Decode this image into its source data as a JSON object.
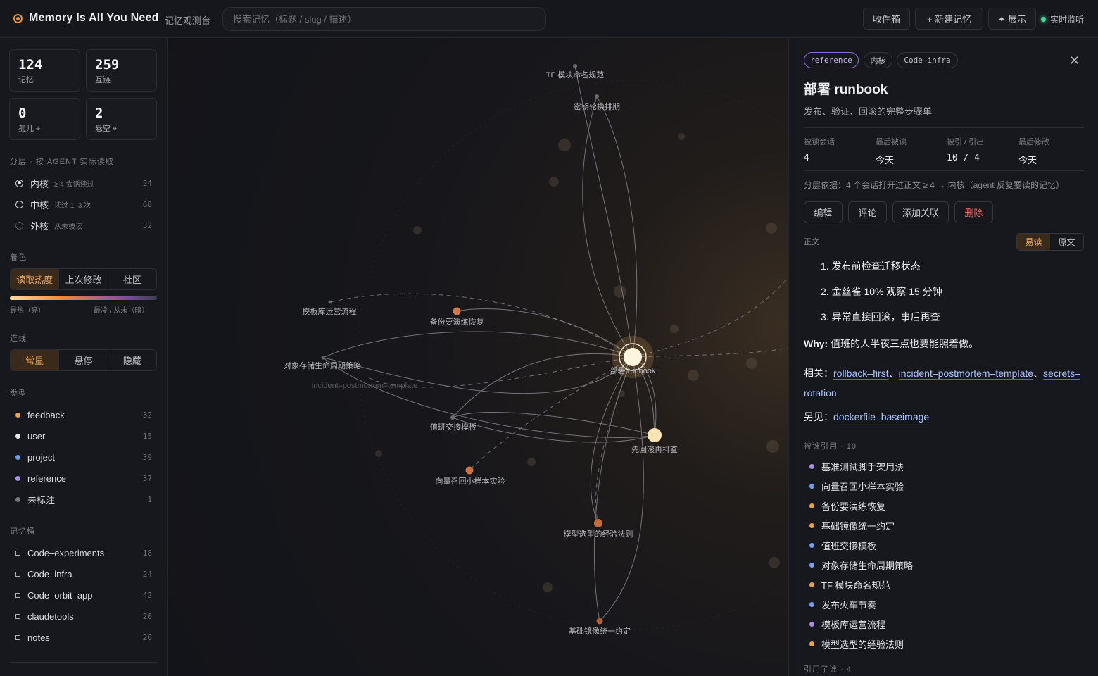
{
  "app": {
    "title": "Memory Is All You Need",
    "subtitle": "记忆观测台"
  },
  "search": {
    "placeholder": "搜索记忆（标题 / slug / 描述）"
  },
  "toolbar": {
    "inbox": "收件箱",
    "new_memory": "+ 新建记忆",
    "show": "✦ 展示",
    "live": "实时监听"
  },
  "stats": [
    {
      "num": "124",
      "label": "记忆"
    },
    {
      "num": "259",
      "label": "互链"
    },
    {
      "num": "0",
      "label": "孤儿 ⌖"
    },
    {
      "num": "2",
      "label": "悬空 ⌖"
    }
  ],
  "layers": {
    "title": "分层 · 按 AGENT 实际读取",
    "items": [
      {
        "name": "内核",
        "hint": "≥ 4 会话读过",
        "count": "24"
      },
      {
        "name": "中核",
        "hint": "读过 1–3 次",
        "count": "68"
      },
      {
        "name": "外核",
        "hint": "从未被读",
        "count": "32"
      }
    ]
  },
  "coloring": {
    "title": "着色",
    "options": [
      "读取热度",
      "上次修改",
      "社区"
    ],
    "hot": "最热（亮）",
    "cold": "最冷 / 从未（暗）"
  },
  "links": {
    "title": "连线",
    "options": [
      "常显",
      "悬停",
      "隐藏"
    ]
  },
  "types": {
    "title": "类型",
    "items": [
      {
        "name": "feedback",
        "count": "32",
        "color": "#f0a040"
      },
      {
        "name": "user",
        "count": "15",
        "color": "#e8e8ee"
      },
      {
        "name": "project",
        "count": "39",
        "color": "#6fa0f0"
      },
      {
        "name": "reference",
        "count": "37",
        "color": "#a98ae8"
      },
      {
        "name": "未标注",
        "count": "1",
        "color": "#777780"
      }
    ]
  },
  "buckets": {
    "title": "记忆桶",
    "items": [
      {
        "name": "Code–experiments",
        "count": "18"
      },
      {
        "name": "Code–infra",
        "count": "24"
      },
      {
        "name": "Code–orbit–app",
        "count": "42"
      },
      {
        "name": "claudetools",
        "count": "20"
      },
      {
        "name": "notes",
        "count": "20"
      }
    ]
  },
  "graph": {
    "nodes": [
      {
        "label": "TF 模块命名规范"
      },
      {
        "label": "密钥轮换排期"
      },
      {
        "label": "模板库运营流程"
      },
      {
        "label": "备份要演练恢复"
      },
      {
        "label": "对象存储生命周期策略"
      },
      {
        "label": "incident–postmortem–template"
      },
      {
        "label": "部署 runbook"
      },
      {
        "label": "值班交接模板"
      },
      {
        "label": "先回滚再排查"
      },
      {
        "label": "向量召回小样本实验"
      },
      {
        "label": "模型选型的经验法则"
      },
      {
        "label": "基础镜像统一约定"
      }
    ]
  },
  "detail": {
    "tags": [
      "reference",
      "内核",
      "Code–infra"
    ],
    "title": "部署 runbook",
    "desc": "发布、验证、回滚的完整步骤单",
    "meta": [
      {
        "k": "被读会话",
        "v": "4"
      },
      {
        "k": "最后被读",
        "v": "今天"
      },
      {
        "k": "被引 / 引出",
        "v": "10 / 4"
      },
      {
        "k": "最后修改",
        "v": "今天"
      }
    ],
    "basis": "分层依据：4 个会话打开过正文 ≥ 4 → 内核（agent 反复要读的记忆）",
    "actions": [
      "编辑",
      "评论",
      "添加关联",
      "删除"
    ],
    "body_label": "正文",
    "view_modes": [
      "易读",
      "原文"
    ],
    "steps": [
      "1. 发布前检查迁移状态",
      "2. 金丝雀 10% 观察 15 分钟",
      "3. 异常直接回滚，事后再查"
    ],
    "why_label": "Why:",
    "why": " 值班的人半夜三点也要能照着做。",
    "related_label": "相关：",
    "related": [
      "rollback–first",
      "incident–postmortem–template",
      "secrets–rotation"
    ],
    "seealso_label": "另见：",
    "seealso": "dockerfile–baseimage",
    "cited_by_title": "被谁引用 · 10",
    "cited_by": [
      {
        "name": "基准测试脚手架用法",
        "color": "#a98ae8"
      },
      {
        "name": "向量召回小样本实验",
        "color": "#6fa0f0"
      },
      {
        "name": "备份要演练恢复",
        "color": "#f0a040"
      },
      {
        "name": "基础镜像统一约定",
        "color": "#f0a040"
      },
      {
        "name": "值班交接模板",
        "color": "#6fa0f0"
      },
      {
        "name": "对象存储生命周期策略",
        "color": "#6fa0f0"
      },
      {
        "name": "TF 模块命名规范",
        "color": "#f0a040"
      },
      {
        "name": "发布火车节奏",
        "color": "#6fa0f0"
      },
      {
        "name": "模板库运营流程",
        "color": "#a98ae8"
      },
      {
        "name": "模型选型的经验法则",
        "color": "#f0a040"
      }
    ],
    "cites_title": "引用了谁 · 4"
  }
}
